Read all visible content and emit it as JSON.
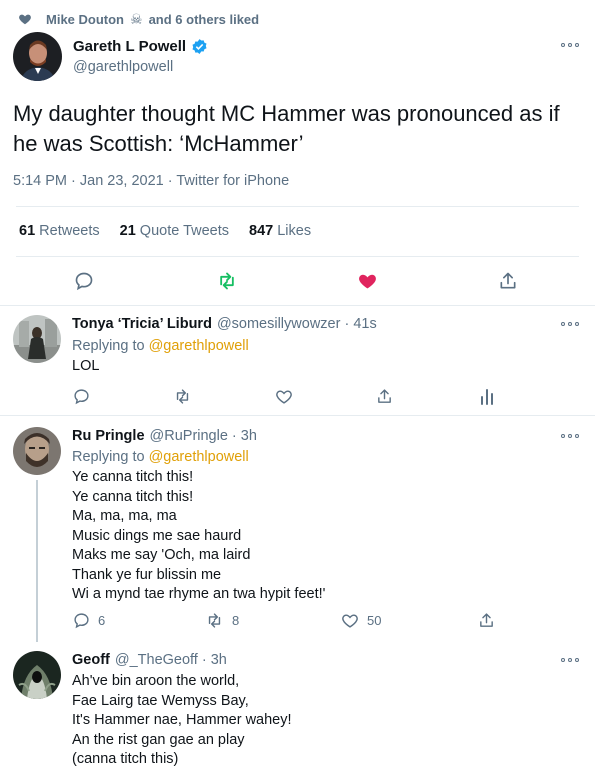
{
  "social_context": {
    "name": "Mike Douton",
    "suffix": "and 6 others liked"
  },
  "main_tweet": {
    "display_name": "Gareth L Powell",
    "handle": "@garethlpowell",
    "text": "My daughter thought MC Hammer was pronounced as if he was Scottish: ‘McHammer’",
    "time": "5:14 PM · Jan 23, 2021 · Twitter for iPhone",
    "stats": [
      {
        "count": "61",
        "label": "Retweets"
      },
      {
        "count": "21",
        "label": "Quote Tweets"
      },
      {
        "count": "847",
        "label": "Likes"
      }
    ]
  },
  "replies": [
    {
      "display_name": "Tonya ‘Tricia’ Liburd",
      "meta": "@somesillywowzer · 41s",
      "replying_prefix": "Replying to",
      "replying_handle": "@garethlpowell",
      "text": "LOL",
      "reply_count": "",
      "retweet_count": "",
      "like_count": ""
    },
    {
      "display_name": "Ru Pringle",
      "meta": "@RuPringle · 3h",
      "replying_prefix": "Replying to",
      "replying_handle": "@garethlpowell",
      "lines": [
        "Ye canna titch this!",
        "Ye canna titch this!",
        "Ma, ma, ma, ma",
        "Music dings me sae haurd",
        "Maks me say 'Och, ma laird",
        "Thank ye fur blissin me",
        "Wi a mynd tae rhyme an twa hypit feet!'"
      ],
      "reply_count": "6",
      "retweet_count": "8",
      "like_count": "50"
    },
    {
      "display_name": "Geoff",
      "meta": "@_TheGeoff · 3h",
      "lines": [
        "Ah've bin aroon the world,",
        "Fae Lairg tae Wemyss Bay,",
        "It's Hammer nae, Hammer wahey!",
        "An the rist gan gae an play",
        "(canna titch this)"
      ]
    }
  ],
  "colors": {
    "like_active": "#e0245e",
    "retweet_active": "#17bf63",
    "verified": "#1da1f2",
    "link": "#e0a008",
    "muted": "#5b7083"
  }
}
